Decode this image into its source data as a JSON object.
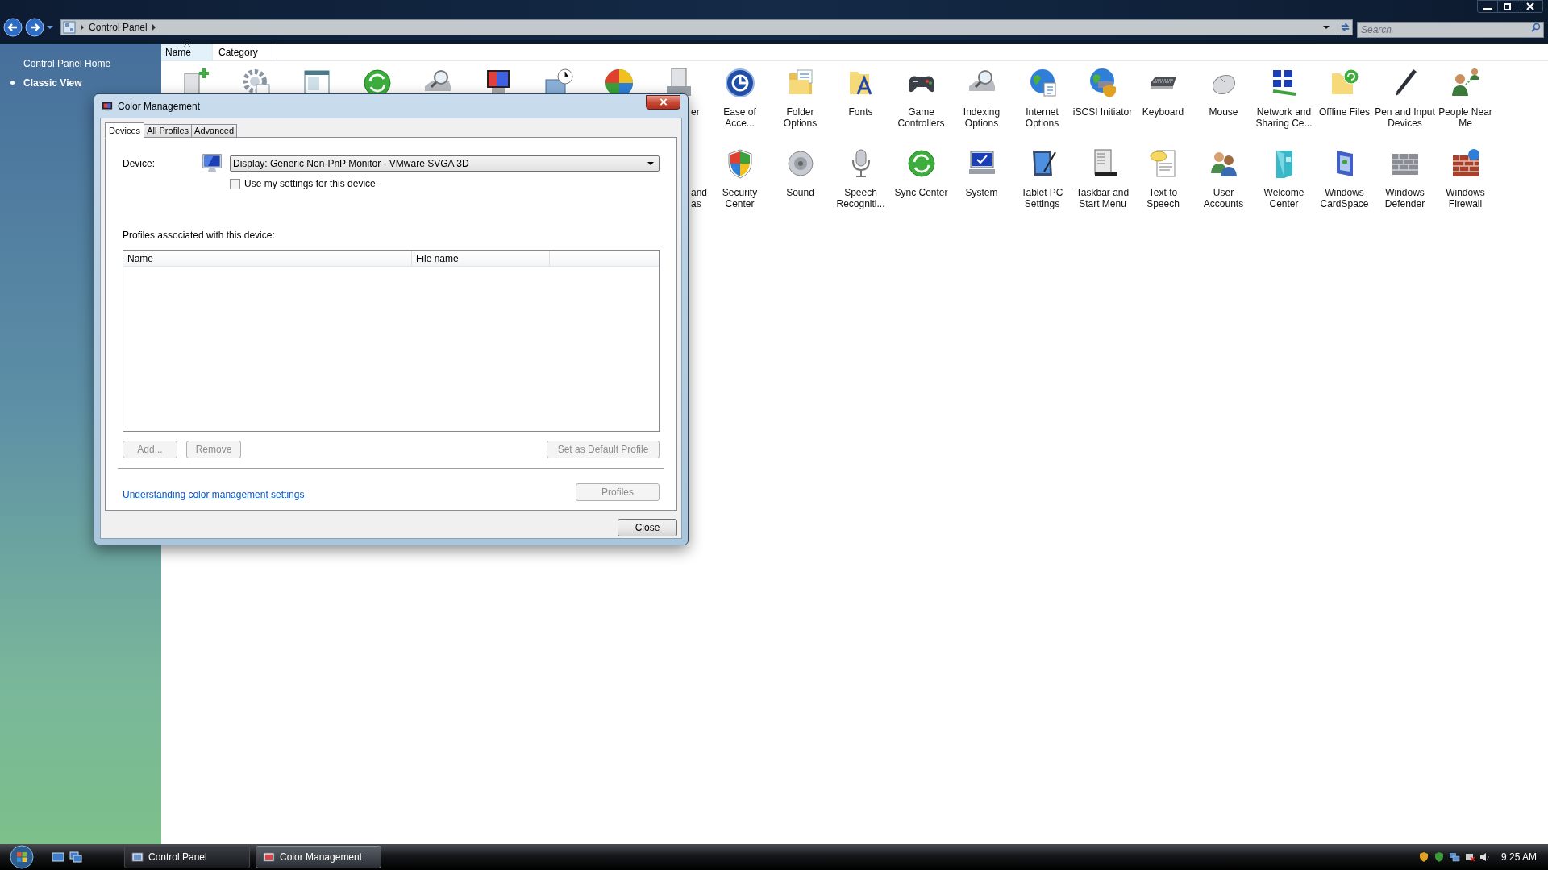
{
  "window": {
    "address": [
      "Control Panel"
    ],
    "search": {
      "placeholder": "Search"
    }
  },
  "sidebar": {
    "items": [
      {
        "label": "Control Panel Home",
        "selected": false
      },
      {
        "label": "Classic View",
        "selected": true
      }
    ]
  },
  "columns": [
    {
      "label": "Name",
      "sorted": true
    },
    {
      "label": "Category",
      "sorted": false
    }
  ],
  "fragments": [
    [
      "er"
    ],
    [
      "and",
      "as"
    ]
  ],
  "rows": [
    [
      {
        "label": "Ease of Acce..."
      },
      {
        "label": "Folder Options"
      },
      {
        "label": "Fonts"
      },
      {
        "label": "Game Controllers"
      },
      {
        "label": "Indexing Options"
      },
      {
        "label": "Internet Options"
      },
      {
        "label": "iSCSI Initiator"
      },
      {
        "label": "Keyboard"
      },
      {
        "label": "Mouse"
      },
      {
        "label": "Network and Sharing Ce..."
      },
      {
        "label": "Offline Files"
      },
      {
        "label": "Pen and Input Devices"
      },
      {
        "label": "People Near Me"
      }
    ],
    [
      {
        "label": "Security Center"
      },
      {
        "label": "Sound"
      },
      {
        "label": "Speech Recogniti..."
      },
      {
        "label": "Sync Center"
      },
      {
        "label": "System"
      },
      {
        "label": "Tablet PC Settings"
      },
      {
        "label": "Taskbar and Start Menu"
      },
      {
        "label": "Text to Speech"
      },
      {
        "label": "User Accounts"
      },
      {
        "label": "Welcome Center"
      },
      {
        "label": "Windows CardSpace"
      },
      {
        "label": "Windows Defender"
      },
      {
        "label": "Windows Firewall"
      }
    ]
  ],
  "dialog": {
    "title": "Color Management",
    "tabs": [
      {
        "label": "Devices",
        "selected": true
      },
      {
        "label": "All Profiles",
        "selected": false
      },
      {
        "label": "Advanced",
        "selected": false
      }
    ],
    "device_label": "Device:",
    "device_value": "Display: Generic Non-PnP Monitor - VMware SVGA 3D",
    "use_my_settings": {
      "label": "Use my settings for this device",
      "checked": false
    },
    "profiles_label": "Profiles associated with this device:",
    "list_columns": [
      "Name",
      "File name"
    ],
    "buttons": [
      {
        "label": "Add...",
        "disabled": true
      },
      {
        "label": "Remove",
        "disabled": true
      },
      {
        "label": "Set as Default Profile",
        "disabled": true
      }
    ],
    "link": "Understanding color management settings",
    "profiles_button": {
      "label": "Profiles",
      "disabled": true
    },
    "close_button": {
      "label": "Close",
      "disabled": false
    }
  },
  "taskbar": {
    "buttons": [
      {
        "label": "Control Panel",
        "selected": false
      },
      {
        "label": "Color Management",
        "selected": true
      }
    ],
    "clock": "9:25 AM"
  }
}
